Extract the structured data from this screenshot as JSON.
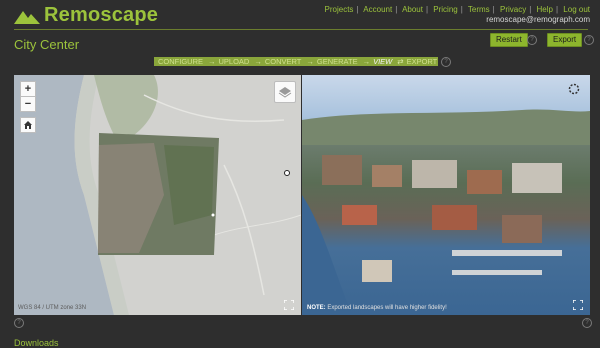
{
  "brand": {
    "name": "Remoscape"
  },
  "nav": {
    "links": [
      "Projects",
      "Account",
      "About",
      "Pricing",
      "Terms",
      "Privacy",
      "Help",
      "Log out"
    ],
    "email": "remoscape@remograph.com"
  },
  "page": {
    "title": "City Center"
  },
  "toolbar": {
    "restart_label": "Restart",
    "export_label": "Export",
    "help_glyph": "?"
  },
  "workflow": {
    "steps": [
      "CONFIGURE",
      "UPLOAD",
      "CONVERT",
      "GENERATE",
      "VIEW",
      "EXPORT"
    ],
    "active": "VIEW",
    "arrow": "→",
    "active_arrow": "⇄"
  },
  "map": {
    "zoom_in": "+",
    "zoom_out": "−",
    "crs": "WGS 84 / UTM zone 33N"
  },
  "viewer": {
    "note_label": "NOTE:",
    "note_text": "Exported landscapes will have higher fidelity!"
  },
  "downloads": {
    "title": "Downloads"
  },
  "colors": {
    "accent": "#9cc33c",
    "button": "#8db52d",
    "background": "#2e2e2e"
  }
}
